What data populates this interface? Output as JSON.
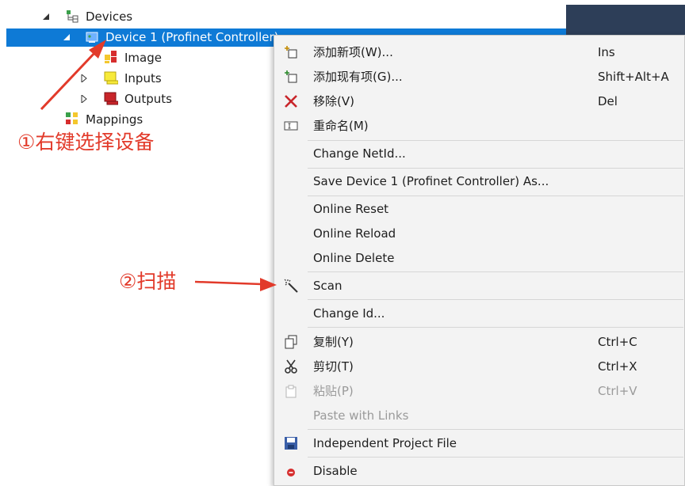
{
  "tree": {
    "devices_label": "Devices",
    "device1_label": "Device 1 (Profinet Controller)",
    "image_label": "Image",
    "inputs_label": "Inputs",
    "outputs_label": "Outputs",
    "mappings_label": "Mappings"
  },
  "annotations": {
    "step1": "①右键选择设备",
    "step2": "②扫描"
  },
  "menu": {
    "add_new": {
      "label": "添加新项(W)...",
      "shortcut": "Ins"
    },
    "add_existing": {
      "label": "添加现有项(G)...",
      "shortcut": "Shift+Alt+A"
    },
    "remove": {
      "label": "移除(V)",
      "shortcut": "Del"
    },
    "rename": {
      "label": "重命名(M)"
    },
    "change_netid": {
      "label": "Change NetId..."
    },
    "save_as": {
      "label": "Save Device 1 (Profinet Controller) As..."
    },
    "online_reset": {
      "label": "Online Reset"
    },
    "online_reload": {
      "label": "Online Reload"
    },
    "online_delete": {
      "label": "Online Delete"
    },
    "scan": {
      "label": "Scan"
    },
    "change_id": {
      "label": "Change Id..."
    },
    "copy": {
      "label": "复制(Y)",
      "shortcut": "Ctrl+C"
    },
    "cut": {
      "label": "剪切(T)",
      "shortcut": "Ctrl+X"
    },
    "paste": {
      "label": "粘贴(P)",
      "shortcut": "Ctrl+V",
      "disabled": true
    },
    "paste_links": {
      "label": "Paste with Links",
      "disabled": true
    },
    "independent_file": {
      "label": "Independent Project File"
    },
    "disable": {
      "label": "Disable"
    }
  },
  "colors": {
    "selection": "#0e7ad6",
    "annotation_red": "#e23a2a",
    "header_dark": "#2d3e58"
  }
}
